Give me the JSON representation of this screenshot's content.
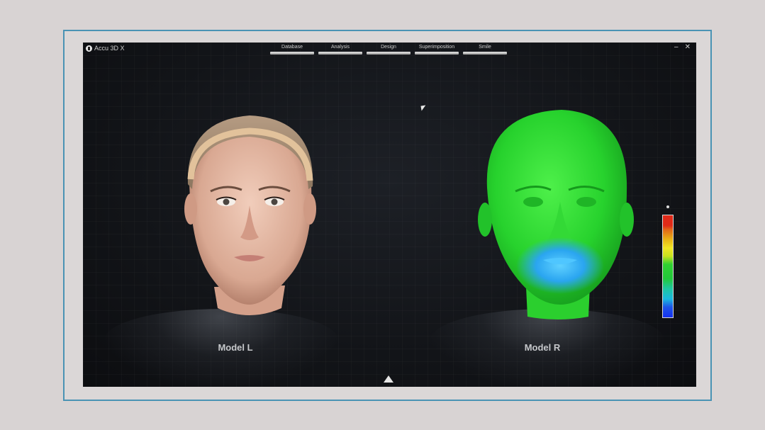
{
  "app": {
    "title": "Accu 3D X"
  },
  "tabs": [
    {
      "label": "Database"
    },
    {
      "label": "Analysis"
    },
    {
      "label": "Design"
    },
    {
      "label": "Superimposition"
    },
    {
      "label": "Smile"
    }
  ],
  "window_controls": {
    "minimize": "–",
    "close": "✕"
  },
  "viewports": {
    "left": {
      "label": "Model L"
    },
    "right": {
      "label": "Model R"
    }
  },
  "colors": {
    "accent_frame": "#4a93b4",
    "heatmap_green": "#2fd12f",
    "heatmap_blue": "#2f8bff",
    "heatmap_red": "#e02a18"
  },
  "icons": {
    "expand": "triangle-up-icon",
    "logo": "plus-circle-icon",
    "cursor": "mouse-pointer-icon"
  }
}
